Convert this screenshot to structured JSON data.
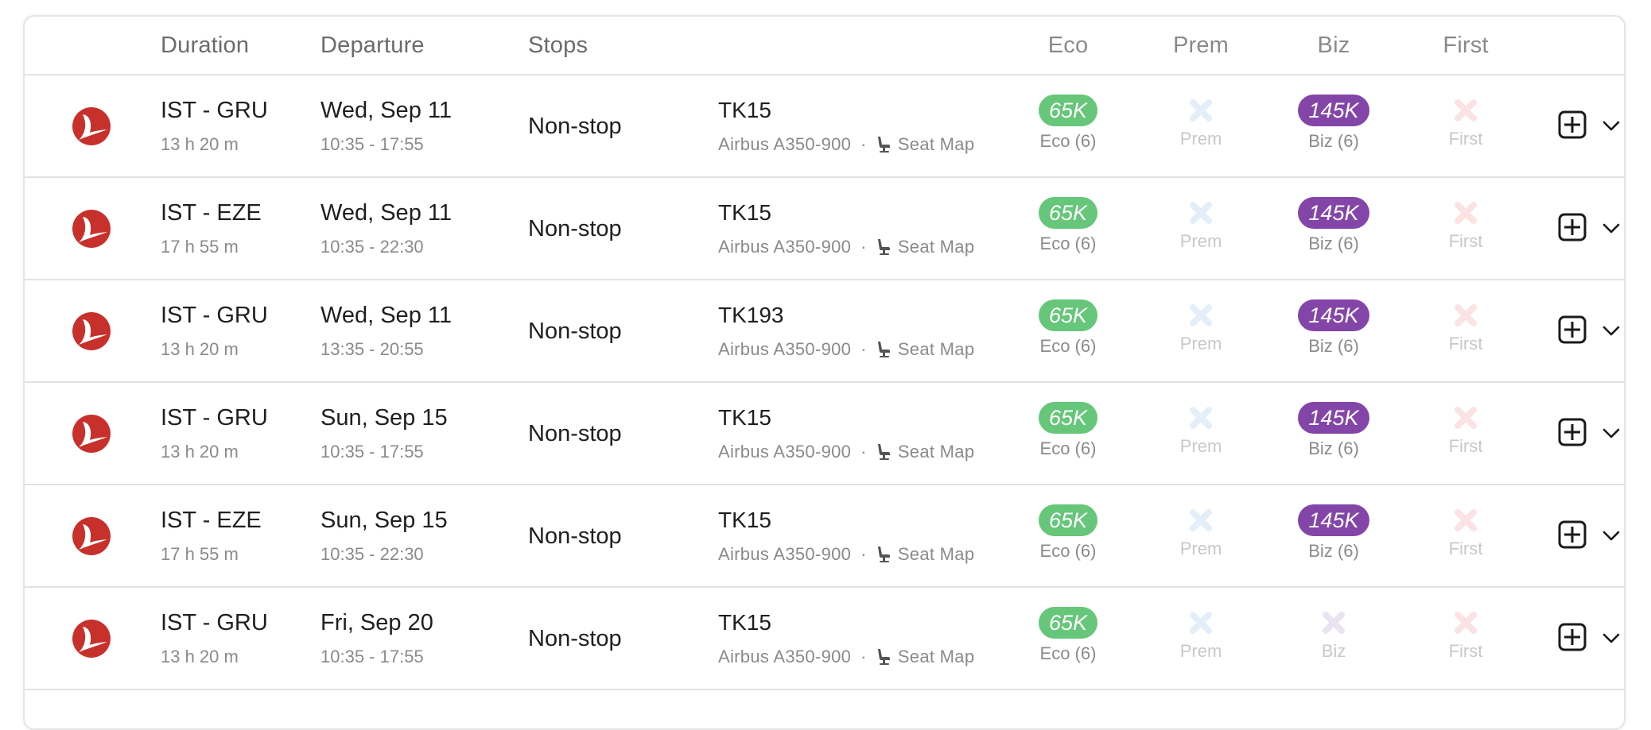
{
  "header": {
    "columns": {
      "duration": "Duration",
      "departure": "Departure",
      "stops": "Stops",
      "eco": "Eco",
      "prem": "Prem",
      "biz": "Biz",
      "first": "First"
    }
  },
  "colors": {
    "eco_pill": "#66c67a",
    "biz_pill": "#8346a8",
    "prem_x": "#e3eef8",
    "biz_x": "#ebe3f2",
    "first_x": "#fbe3e3",
    "airline_red": "#c8302c"
  },
  "icons": {
    "airline_logo": "turkish-airlines-logo",
    "seat": "seat-icon",
    "unavailable": "x-icon",
    "add": "plus-square-icon",
    "expand": "chevron-down-icon"
  },
  "flights": [
    {
      "route": "IST - GRU",
      "duration": "13 h 20 m",
      "date": "Wed, Sep 11",
      "times": "10:35 - 17:55",
      "stops": "Non-stop",
      "flight_no": "TK15",
      "aircraft": "Airbus A350-900",
      "separator": "·",
      "seat_map": "Seat Map",
      "eco": {
        "available": true,
        "price": "65K",
        "label": "Eco (6)"
      },
      "prem": {
        "available": false,
        "label": "Prem"
      },
      "biz": {
        "available": true,
        "price": "145K",
        "label": "Biz (6)"
      },
      "first": {
        "available": false,
        "label": "First"
      }
    },
    {
      "route": "IST - EZE",
      "duration": "17 h 55 m",
      "date": "Wed, Sep 11",
      "times": "10:35 - 22:30",
      "stops": "Non-stop",
      "flight_no": "TK15",
      "aircraft": "Airbus A350-900",
      "separator": "·",
      "seat_map": "Seat Map",
      "eco": {
        "available": true,
        "price": "65K",
        "label": "Eco (6)"
      },
      "prem": {
        "available": false,
        "label": "Prem"
      },
      "biz": {
        "available": true,
        "price": "145K",
        "label": "Biz (6)"
      },
      "first": {
        "available": false,
        "label": "First"
      }
    },
    {
      "route": "IST - GRU",
      "duration": "13 h 20 m",
      "date": "Wed, Sep 11",
      "times": "13:35 - 20:55",
      "stops": "Non-stop",
      "flight_no": "TK193",
      "aircraft": "Airbus A350-900",
      "separator": "·",
      "seat_map": "Seat Map",
      "eco": {
        "available": true,
        "price": "65K",
        "label": "Eco (6)"
      },
      "prem": {
        "available": false,
        "label": "Prem"
      },
      "biz": {
        "available": true,
        "price": "145K",
        "label": "Biz (6)"
      },
      "first": {
        "available": false,
        "label": "First"
      }
    },
    {
      "route": "IST - GRU",
      "duration": "13 h 20 m",
      "date": "Sun, Sep 15",
      "times": "10:35 - 17:55",
      "stops": "Non-stop",
      "flight_no": "TK15",
      "aircraft": "Airbus A350-900",
      "separator": "·",
      "seat_map": "Seat Map",
      "eco": {
        "available": true,
        "price": "65K",
        "label": "Eco (6)"
      },
      "prem": {
        "available": false,
        "label": "Prem"
      },
      "biz": {
        "available": true,
        "price": "145K",
        "label": "Biz (6)"
      },
      "first": {
        "available": false,
        "label": "First"
      }
    },
    {
      "route": "IST - EZE",
      "duration": "17 h 55 m",
      "date": "Sun, Sep 15",
      "times": "10:35 - 22:30",
      "stops": "Non-stop",
      "flight_no": "TK15",
      "aircraft": "Airbus A350-900",
      "separator": "·",
      "seat_map": "Seat Map",
      "eco": {
        "available": true,
        "price": "65K",
        "label": "Eco (6)"
      },
      "prem": {
        "available": false,
        "label": "Prem"
      },
      "biz": {
        "available": true,
        "price": "145K",
        "label": "Biz (6)"
      },
      "first": {
        "available": false,
        "label": "First"
      }
    },
    {
      "route": "IST - GRU",
      "duration": "13 h 20 m",
      "date": "Fri, Sep 20",
      "times": "10:35 - 17:55",
      "stops": "Non-stop",
      "flight_no": "TK15",
      "aircraft": "Airbus A350-900",
      "separator": "·",
      "seat_map": "Seat Map",
      "eco": {
        "available": true,
        "price": "65K",
        "label": "Eco (6)"
      },
      "prem": {
        "available": false,
        "label": "Prem"
      },
      "biz": {
        "available": false,
        "label": "Biz"
      },
      "first": {
        "available": false,
        "label": "First"
      }
    }
  ]
}
